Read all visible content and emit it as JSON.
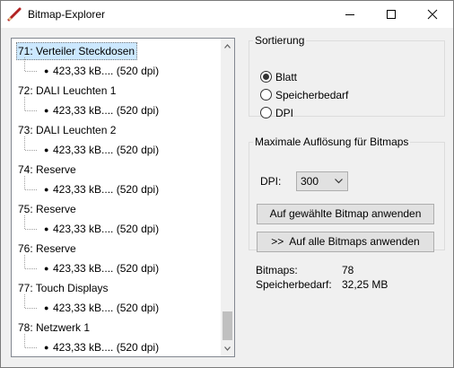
{
  "window": {
    "title": "Bitmap-Explorer",
    "minimize_icon": "minimize-icon",
    "maximize_icon": "maximize-icon",
    "close_icon": "close-icon"
  },
  "tree": {
    "selected_index": 0,
    "items": [
      {
        "label": "71: Verteiler Steckdosen",
        "child": "423,33 kB.... (520 dpi)"
      },
      {
        "label": "72: DALI Leuchten 1",
        "child": "423,33 kB.... (520 dpi)"
      },
      {
        "label": "73: DALI Leuchten 2",
        "child": "423,33 kB.... (520 dpi)"
      },
      {
        "label": "74: Reserve",
        "child": "423,33 kB.... (520 dpi)"
      },
      {
        "label": "75: Reserve",
        "child": "423,33 kB.... (520 dpi)"
      },
      {
        "label": "76: Reserve",
        "child": "423,33 kB.... (520 dpi)"
      },
      {
        "label": "77: Touch Displays",
        "child": "423,33 kB.... (520 dpi)"
      },
      {
        "label": "78: Netzwerk 1",
        "child": "423,33 kB.... (520 dpi)"
      }
    ],
    "bullet": "●"
  },
  "sorting": {
    "legend": "Sortierung",
    "options": [
      "Blatt",
      "Speicherbedarf",
      "DPI"
    ],
    "selected": "Blatt"
  },
  "resolution": {
    "legend": "Maximale Auflösung für Bitmaps",
    "dpi_label": "DPI:",
    "dpi_value": "300",
    "apply_selected_label": "Auf gewählte Bitmap anwenden",
    "apply_all_label": ">>  Auf alle Bitmaps anwenden"
  },
  "stats": {
    "bitmaps_label": "Bitmaps:",
    "bitmaps_value": "78",
    "memory_label": "Speicherbedarf:",
    "memory_value": "32,25 MB"
  }
}
